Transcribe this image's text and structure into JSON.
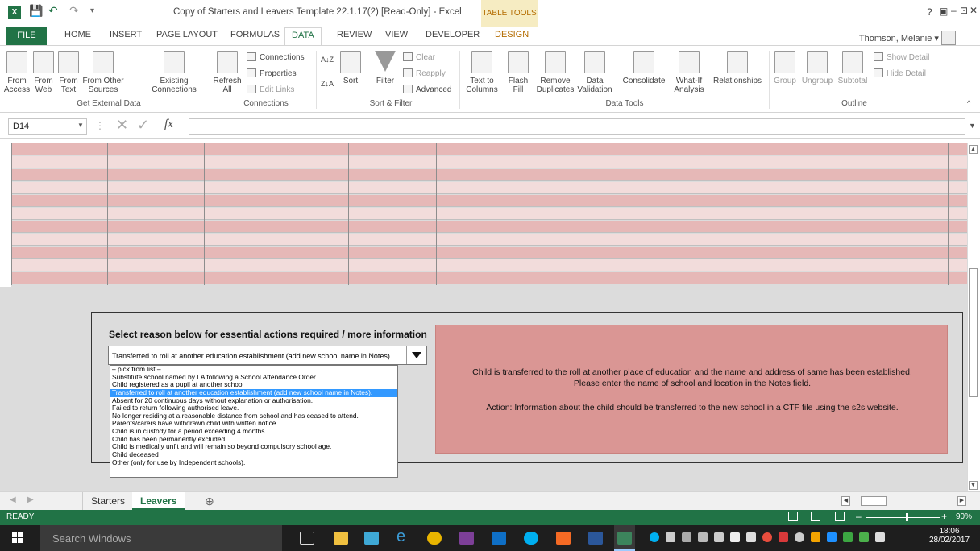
{
  "window": {
    "title": "Copy of Starters and Leavers Template 22.1.17(2)  [Read-Only] - Excel",
    "table_tools": "TABLE TOOLS",
    "controls": [
      "?",
      "▣",
      "–",
      "⊡",
      "✕"
    ]
  },
  "ribbon_tabs": {
    "file": "FILE",
    "items": [
      "HOME",
      "INSERT",
      "PAGE LAYOUT",
      "FORMULAS",
      "DATA",
      "REVIEW",
      "VIEW",
      "DEVELOPER"
    ],
    "design": "DESIGN",
    "active": "DATA",
    "user": "Thomson, Melanie"
  },
  "ribbon": {
    "get_external": {
      "from_access": "From Access",
      "from_web": "From Web",
      "from_text": "From Text",
      "from_other": "From Other Sources",
      "existing": "Existing Connections",
      "label": "Get External Data"
    },
    "connections": {
      "refresh": "Refresh All",
      "connections": "Connections",
      "properties": "Properties",
      "edit_links": "Edit Links",
      "label": "Connections"
    },
    "sort_filter": {
      "sort": "Sort",
      "filter": "Filter",
      "clear": "Clear",
      "reapply": "Reapply",
      "advanced": "Advanced",
      "label": "Sort & Filter"
    },
    "data_tools": {
      "text_to_columns": "Text to Columns",
      "flash_fill": "Flash Fill",
      "remove_duplicates": "Remove Duplicates",
      "data_validation": "Data Validation",
      "consolidate": "Consolidate",
      "what_if": "What-If Analysis",
      "relationships": "Relationships",
      "label": "Data Tools"
    },
    "outline": {
      "group": "Group",
      "ungroup": "Ungroup",
      "subtotal": "Subtotal",
      "show_detail": "Show Detail",
      "hide_detail": "Hide Detail",
      "label": "Outline"
    }
  },
  "formula_bar": {
    "name_box": "D14",
    "fx": "fx",
    "value": ""
  },
  "panel": {
    "heading": "Select reason below for essential actions required / more information",
    "combo_value": "Transferred to roll at another education establishment (add new school name in Notes).",
    "options": [
      "– pick from list –",
      "Substitute school named by LA following a School Attendance Order",
      "Child registered as a pupil at another school",
      "Transferred to roll at another education establishment (add new school name in Notes).",
      "Absent for 20 continuous days without explanation or authorisation.",
      "Failed to return following authorised leave.",
      "No longer residing at a reasonable distance from school and has ceased to attend.",
      "Parents/carers have withdrawn child with written notice.",
      "Child is in custody for a period exceeding 4 months.",
      "Child has been permanently excluded.",
      "Child is medically unfit and will remain so beyond compulsory school age.",
      "Child deceased",
      "Other (only for use by Independent schools)."
    ],
    "selected_index": 3,
    "info_line1": "Child is transferred to the roll at another place of education and the name and address of same has been established.",
    "info_line2": "Please enter the name of school and location in the Notes field.",
    "info_line3": "Action: Information about the child should be transferred to the new school in a CTF file using the s2s website."
  },
  "sheets": {
    "tabs": [
      "Starters",
      "Leavers"
    ],
    "active": "Leavers",
    "add": "⊕"
  },
  "status": {
    "ready": "READY",
    "zoom": "90%"
  },
  "taskbar": {
    "search": "Search Windows",
    "time": "18:06",
    "date": "28/02/2017"
  },
  "colors": {
    "excel_green": "#217346",
    "row_dark": "#e6b8b7",
    "row_light": "#f2dcdb",
    "info_box": "#da9694",
    "selection": "#3399ff"
  }
}
